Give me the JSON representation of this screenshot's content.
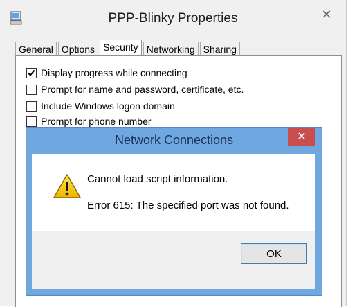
{
  "window": {
    "title": "PPP-Blinky Properties",
    "close_glyph": "✕",
    "tabs": [
      {
        "label": "General"
      },
      {
        "label": "Options"
      },
      {
        "label": "Security",
        "active": true
      },
      {
        "label": "Networking"
      },
      {
        "label": "Sharing"
      }
    ],
    "options": [
      {
        "label": "Display progress while connecting",
        "checked": true
      },
      {
        "label": "Prompt for name and password, certificate, etc.",
        "checked": false
      },
      {
        "label": "Include Windows logon domain",
        "checked": false
      },
      {
        "label": "Prompt for phone number",
        "checked": false
      }
    ]
  },
  "dialog": {
    "title": "Network Connections",
    "close_glyph": "✕",
    "icon": "warning-icon",
    "message": "Cannot load script information.",
    "detail": "Error 615: The specified port was not found.",
    "ok_label": "OK"
  },
  "colors": {
    "dialog_frame": "#6fa7e0",
    "close_red": "#c94f4f",
    "warning_yellow": "#f5c400"
  }
}
